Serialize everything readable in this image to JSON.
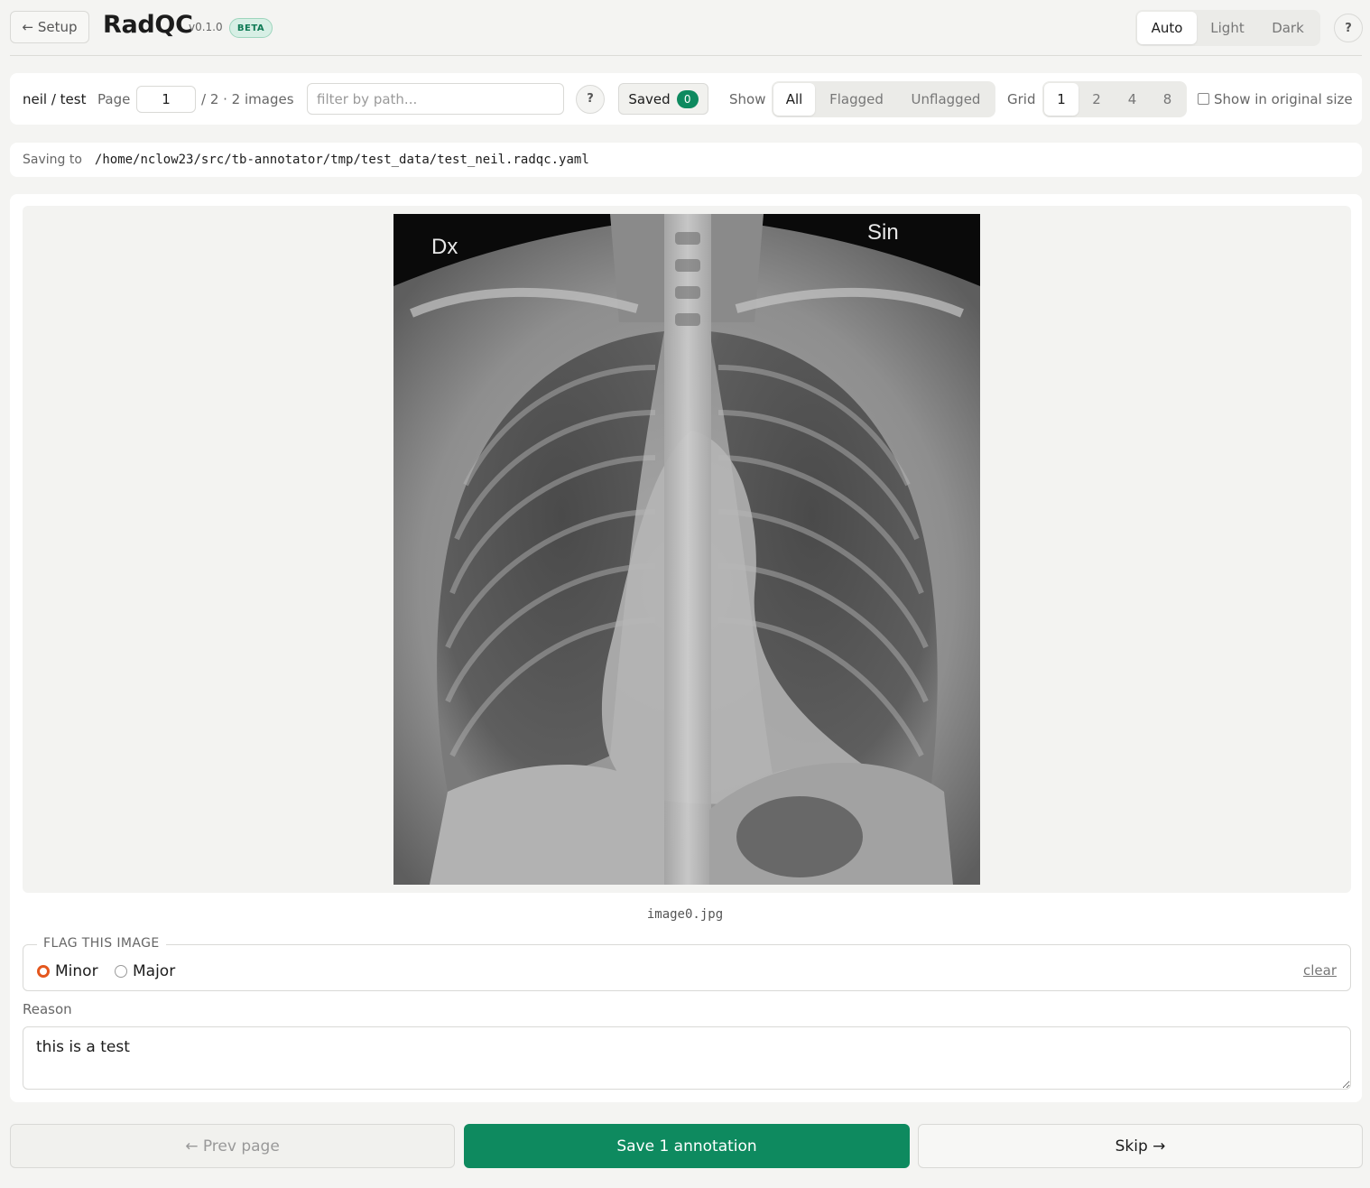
{
  "header": {
    "setup_label": "← Setup",
    "app_name": "RadQC",
    "version": "v0.1.0",
    "beta_label": "BETA",
    "theme": {
      "options": [
        "Auto",
        "Light",
        "Dark"
      ],
      "selected": "Auto"
    },
    "help_label": "?"
  },
  "toolbar": {
    "breadcrumb": "neil / test",
    "page_label": "Page",
    "page_value": "1",
    "page_info": "/ 2 · 2 images",
    "filter_placeholder": "filter by path...",
    "filter_help": "?",
    "saved_label": "Saved",
    "saved_count": "0",
    "show_label": "Show",
    "show_options": [
      "All",
      "Flagged",
      "Unflagged"
    ],
    "show_selected": "All",
    "grid_label": "Grid",
    "grid_options": [
      "1",
      "2",
      "4",
      "8"
    ],
    "grid_selected": "1",
    "original_size_label": "Show in original size",
    "original_size_checked": false
  },
  "save_path": {
    "label": "Saving to",
    "path": "/home/nclow23/src/tb-annotator/tmp/test_data/test_neil.radqc.yaml"
  },
  "viewer": {
    "marker_left": "Dx",
    "marker_right": "Sin",
    "filename": "image0.jpg"
  },
  "flag": {
    "legend": "FLAG THIS IMAGE",
    "options": [
      "Minor",
      "Major"
    ],
    "selected": "Minor",
    "clear_label": "clear"
  },
  "reason": {
    "label": "Reason",
    "value": "this is a test"
  },
  "footer": {
    "prev_label": "← Prev page",
    "save_label": "Save 1 annotation",
    "skip_label": "Skip →"
  },
  "colors": {
    "accent": "#0e8a5f",
    "flag_selected": "#e4571e",
    "background": "#f4f4f2"
  }
}
